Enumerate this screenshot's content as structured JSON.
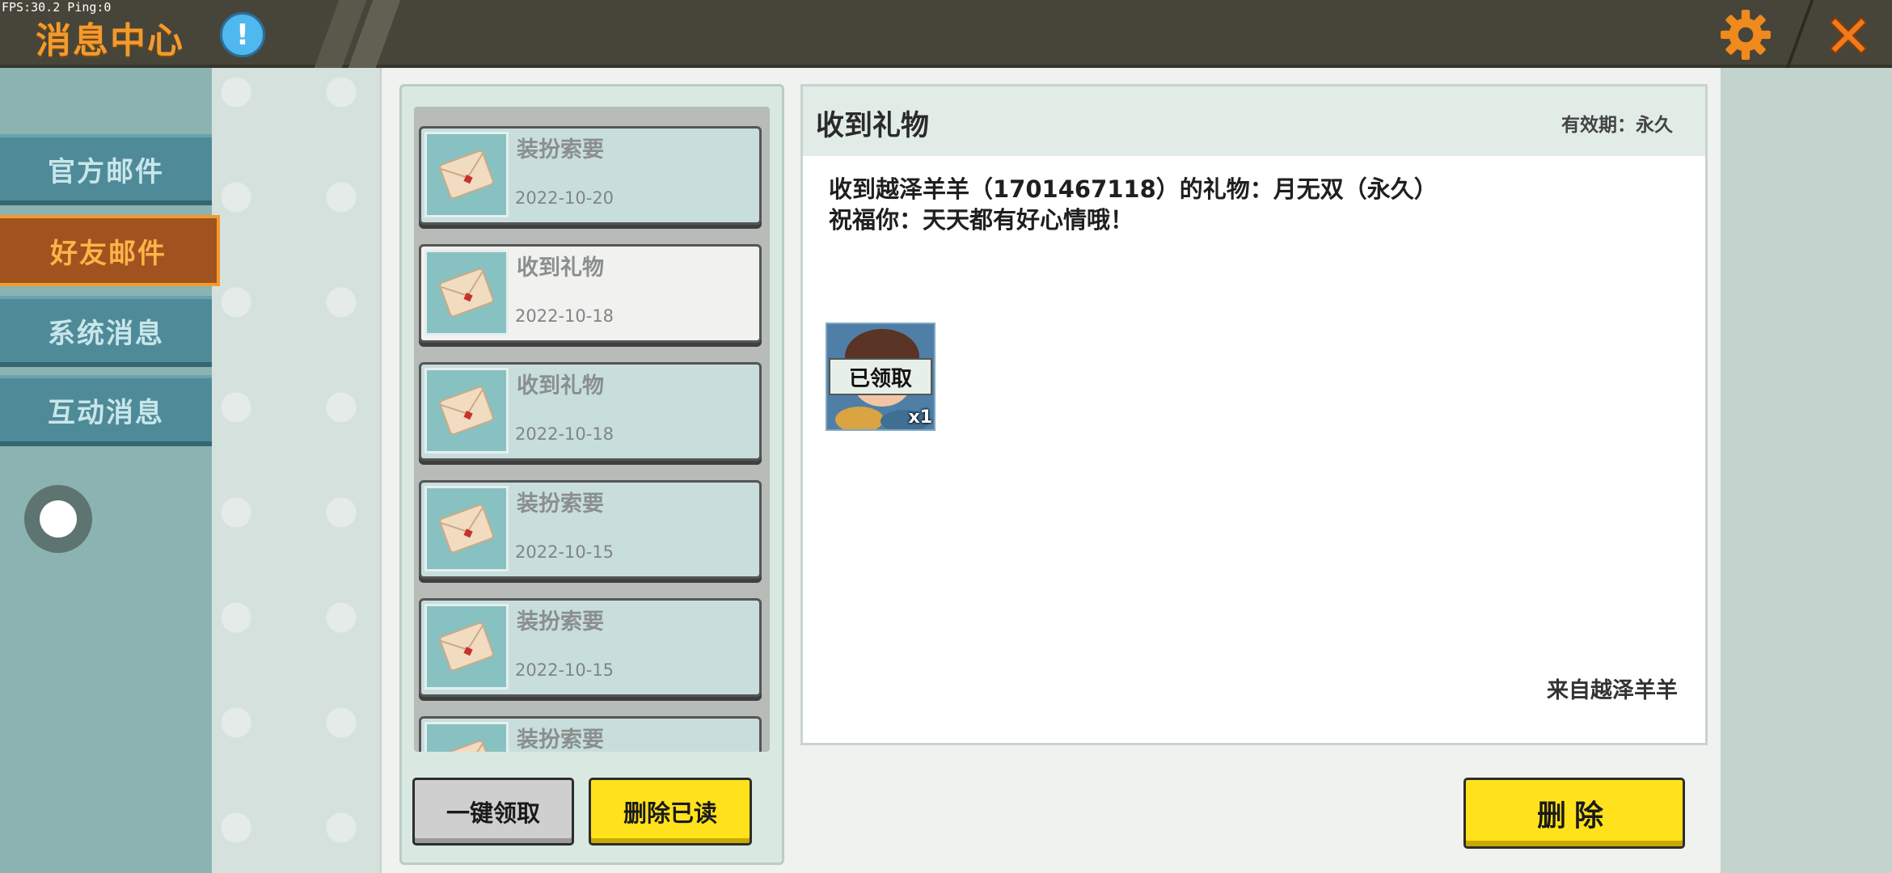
{
  "status": {
    "fps_text": "FPS:30.2  Ping:0"
  },
  "header": {
    "title": "消息中心",
    "info_icon": "info-icon",
    "info_glyph": "!",
    "settings_icon": "gear-icon",
    "close_icon": "close-icon"
  },
  "sidebar": {
    "tabs": [
      {
        "label": "官方邮件",
        "active": false
      },
      {
        "label": "好友邮件",
        "active": true
      },
      {
        "label": "系统消息",
        "active": false
      },
      {
        "label": "互动消息",
        "active": false
      }
    ]
  },
  "mail_list": {
    "items": [
      {
        "subject": "装扮索要",
        "date": "2022-10-20",
        "selected": false
      },
      {
        "subject": "收到礼物",
        "date": "2022-10-18",
        "selected": true
      },
      {
        "subject": "收到礼物",
        "date": "2022-10-18",
        "selected": false
      },
      {
        "subject": "装扮索要",
        "date": "2022-10-15",
        "selected": false
      },
      {
        "subject": "装扮索要",
        "date": "2022-10-15",
        "selected": false
      },
      {
        "subject": "装扮索要",
        "date": "",
        "selected": false
      }
    ],
    "claim_all_label": "一键领取",
    "delete_read_label": "删除已读"
  },
  "detail": {
    "title": "收到礼物",
    "validity": "有效期：永久",
    "body_line1": "收到越泽羊羊（1701467118）的礼物：月无双（永久）",
    "body_line2": "祝福你：天天都有好心情哦！",
    "gift": {
      "status": "已领取",
      "count": "x1"
    },
    "sender": "来自越泽羊羊",
    "delete_label": "删除"
  },
  "colors": {
    "header_bg": "#474539",
    "title_orange": "#f39a2d",
    "tab_teal": "#4f8a98",
    "tab_active": "#a0531f",
    "button_yellow": "#ffe21c"
  }
}
